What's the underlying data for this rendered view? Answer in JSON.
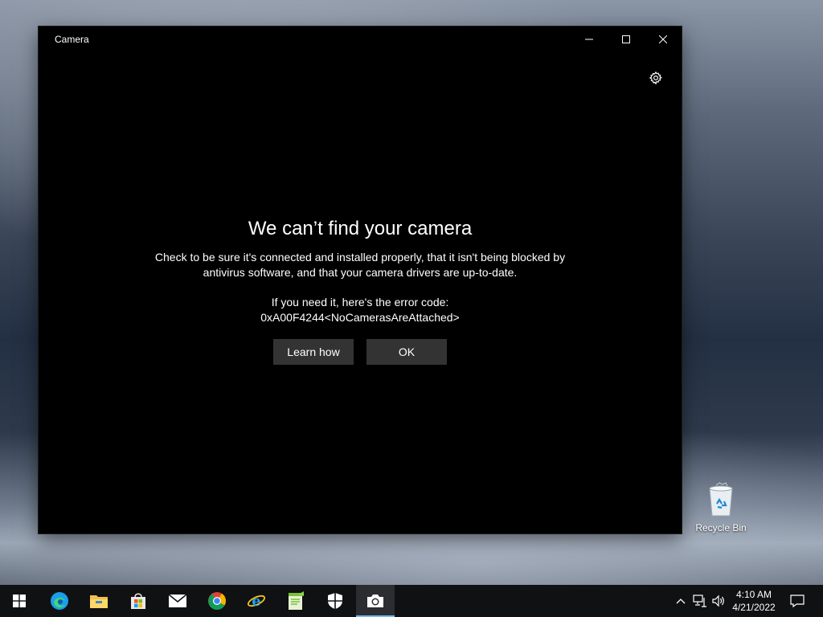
{
  "window": {
    "title": "Camera"
  },
  "error": {
    "title": "We can’t find your camera",
    "description": "Check to be sure it's connected and installed properly, that it isn't being blocked by antivirus software, and that your camera drivers are up-to-date.",
    "code_intro": "If you need it, here's the error code:",
    "code": "0xA00F4244<NoCamerasAreAttached>",
    "learn_how_label": "Learn how",
    "ok_label": "OK"
  },
  "desktop": {
    "recycle_bin_label": "Recycle Bin"
  },
  "taskbar": {
    "apps": [
      {
        "name": "start-button",
        "icon": "windows-logo-icon"
      },
      {
        "name": "edge",
        "icon": "edge-icon"
      },
      {
        "name": "file-explorer",
        "icon": "folder-icon"
      },
      {
        "name": "microsoft-store",
        "icon": "store-icon"
      },
      {
        "name": "mail",
        "icon": "mail-icon"
      },
      {
        "name": "chrome",
        "icon": "chrome-icon"
      },
      {
        "name": "internet-explorer",
        "icon": "ie-icon"
      },
      {
        "name": "notepad-plus",
        "icon": "notepad-icon"
      },
      {
        "name": "windows-security",
        "icon": "shield-icon"
      },
      {
        "name": "camera",
        "icon": "camera-icon",
        "active": true
      }
    ],
    "tray": {
      "time": "4:10 AM",
      "date": "4/21/2022"
    }
  },
  "colors": {
    "accent": "#76b9ed",
    "taskbar": "#101113",
    "button": "#333333"
  }
}
